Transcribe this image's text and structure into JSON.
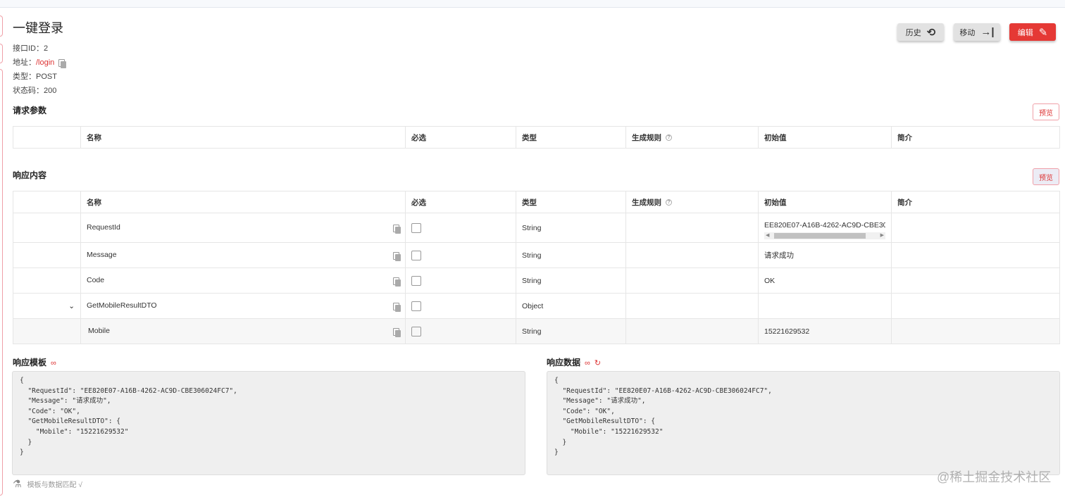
{
  "title": "一键登录",
  "meta": {
    "id_label": "接口ID：",
    "id": "2",
    "addr_label": "地址：",
    "addr": "/login",
    "type_label": "类型：",
    "type": "POST",
    "status_label": "状态码：",
    "status": "200"
  },
  "buttons": {
    "history": "历史",
    "move": "移动",
    "edit": "编辑"
  },
  "request": {
    "title": "请求参数",
    "preview": "预览"
  },
  "response": {
    "title": "响应内容",
    "preview": "预览"
  },
  "columns": [
    "名称",
    "必选",
    "类型",
    "生成规则",
    "初始值",
    "简介"
  ],
  "rows": [
    {
      "name": "RequestId",
      "type": "String",
      "initial": "EE820E07-A16B-4262-AC9D-CBE306024FC7"
    },
    {
      "name": "Message",
      "type": "String",
      "initial": "请求成功"
    },
    {
      "name": "Code",
      "type": "String",
      "initial": "OK"
    },
    {
      "name": "GetMobileResultDTO",
      "type": "Object",
      "initial": ""
    },
    {
      "name": "Mobile",
      "type": "String",
      "initial": "15221629532"
    }
  ],
  "template": {
    "title": "响应模板",
    "code": "{\n  \"RequestId\": \"EE820E07-A16B-4262-AC9D-CBE306024FC7\",\n  \"Message\": \"请求成功\",\n  \"Code\": \"OK\",\n  \"GetMobileResultDTO\": {\n    \"Mobile\": \"15221629532\"\n  }\n}"
  },
  "data": {
    "title": "响应数据",
    "code": "{\n  \"RequestId\": \"EE820E07-A16B-4262-AC9D-CBE306024FC7\",\n  \"Message\": \"请求成功\",\n  \"Code\": \"OK\",\n  \"GetMobileResultDTO\": {\n    \"Mobile\": \"15221629532\"\n  }\n}"
  },
  "match_text": "模板与数据匹配 √",
  "watermark": "@稀土掘金技术社区"
}
